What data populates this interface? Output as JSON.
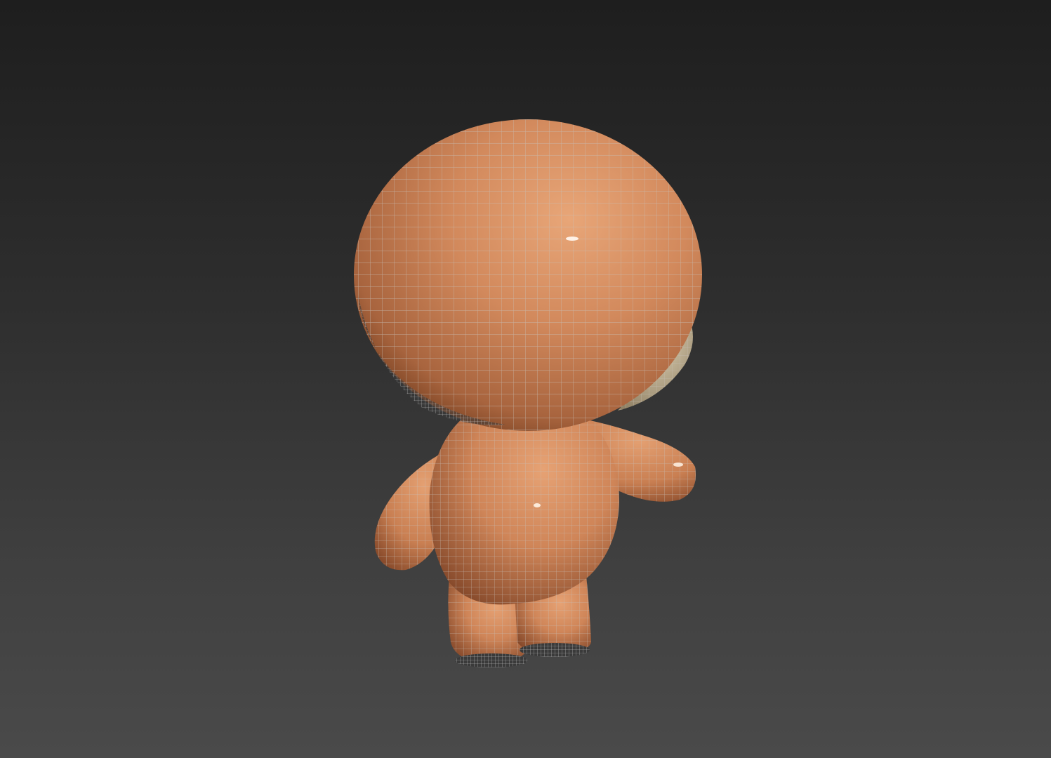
{
  "viewport": {
    "background_top": "#1e1e1e",
    "background_bottom": "#4a4a4a"
  },
  "model": {
    "skin_color": "#d18a5e",
    "skin_shadow": "#8e5232",
    "skin_highlight": "#efb28a",
    "wire_color": "#b9b2ac",
    "hair_color": "#d8c9a8"
  }
}
